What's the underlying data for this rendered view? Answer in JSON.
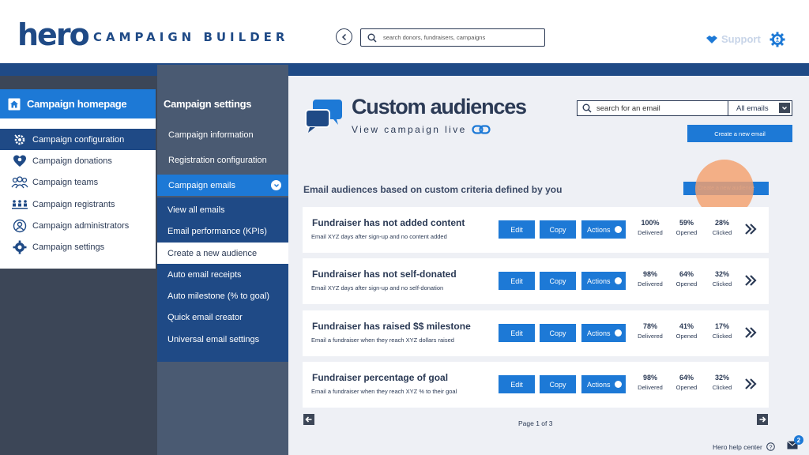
{
  "header": {
    "logo": "hero",
    "app_title": "CAMPAIGN BUILDER",
    "search_placeholder": "search donors, fundraisers, campaigns",
    "support_label": "Support"
  },
  "sidebar": {
    "home_label": "Campaign homepage",
    "items": [
      {
        "label": "Campaign configuration",
        "icon": "gear-wrench-icon",
        "active": true
      },
      {
        "label": "Campaign donations",
        "icon": "heart-donation-icon",
        "active": false
      },
      {
        "label": "Campaign teams",
        "icon": "team-icon",
        "active": false
      },
      {
        "label": "Campaign registrants",
        "icon": "registrants-icon",
        "active": false
      },
      {
        "label": "Campaign administrators",
        "icon": "admin-icon",
        "active": false
      },
      {
        "label": "Campaign settings",
        "icon": "gear-icon",
        "active": false
      }
    ]
  },
  "settings_menu": {
    "title": "Campaign settings",
    "items": [
      "Campaign information",
      "Registration configuration"
    ],
    "emails_label": "Campaign emails",
    "sub_items": [
      "View all emails",
      "Email performance (KPIs)",
      "Create a new audience",
      "Auto email receipts",
      "Auto milestone (% to goal)",
      "Quick email creator",
      "Universal email settings"
    ],
    "selected_sub": "Create a new audience"
  },
  "main": {
    "title": "Custom audiences",
    "view_live": "View campaign live",
    "email_search_placeholder": "search for an email",
    "filter_value": "All emails",
    "create_email_label": "Create a new email",
    "section_heading": "Email audiences based on custom criteria defined by you",
    "create_audience_label": "Create a new audience",
    "buttons": {
      "edit": "Edit",
      "copy": "Copy",
      "actions": "Actions"
    },
    "stat_labels": {
      "delivered": "Delivered",
      "opened": "Opened",
      "clicked": "Clicked"
    },
    "audiences": [
      {
        "title": "Fundraiser has not added content",
        "desc": "Email XYZ days after sign-up and no content added",
        "delivered": "100%",
        "opened": "59%",
        "clicked": "28%"
      },
      {
        "title": "Fundraiser has not self-donated",
        "desc": "Email XYZ days after sign-up and no self-donation",
        "delivered": "98%",
        "opened": "64%",
        "clicked": "32%"
      },
      {
        "title": "Fundraiser has raised $$ milestone",
        "desc": "Email a fundraiser when they reach XYZ dollars raised",
        "delivered": "78%",
        "opened": "41%",
        "clicked": "17%"
      },
      {
        "title": "Fundraiser percentage of goal",
        "desc": "Email a fundraiser when they reach XYZ % to their goal",
        "delivered": "98%",
        "opened": "64%",
        "clicked": "32%"
      }
    ],
    "pagination": "Page 1 of 3"
  },
  "footer": {
    "help_label": "Hero help center",
    "mail_count": "2"
  },
  "colors": {
    "brand_navy": "#1f4a86",
    "accent_blue": "#1d79d6",
    "dark_slate": "#3c4657"
  }
}
